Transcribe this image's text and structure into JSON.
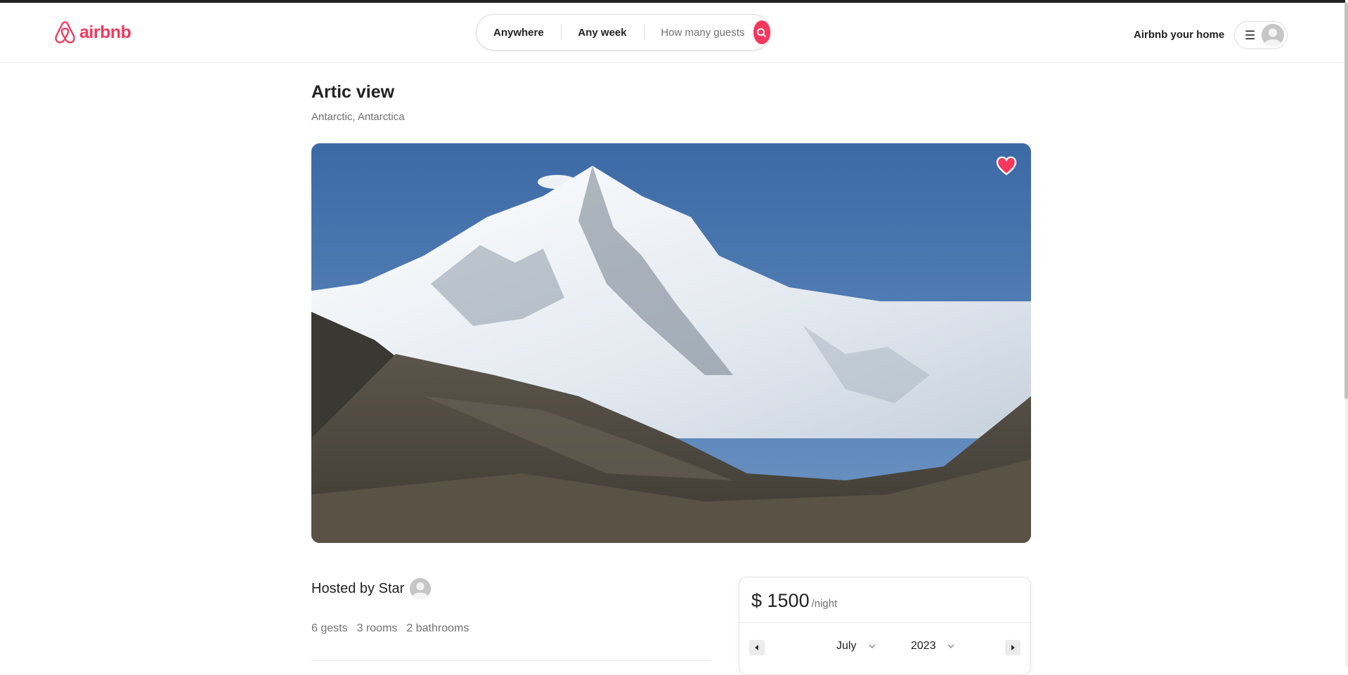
{
  "header": {
    "brand": "airbnb",
    "search": {
      "where": "Anywhere",
      "when": "Any week",
      "guests": "How many guests"
    },
    "host_link": "Airbnb your home",
    "menu_icon": "☰"
  },
  "listing": {
    "title": "Artic view",
    "location": "Antarctic, Antarctica",
    "favorited": true,
    "host_label": "Hosted by Star",
    "stats": [
      "6 gests",
      "3 rooms",
      "2 bathrooms"
    ]
  },
  "booking": {
    "price": "$ 1500",
    "per_night": "/night",
    "calendar": {
      "month": "July",
      "year": "2023"
    }
  },
  "colors": {
    "brand": "#F5385D",
    "text": "#222222",
    "muted": "#717171",
    "border": "#dddddd"
  },
  "icons": {
    "logo": "airbnb-logo-icon",
    "search": "search-icon",
    "menu": "hamburger-menu-icon",
    "avatar": "user-avatar-icon",
    "favorite": "heart-icon",
    "prev": "chevron-left-icon",
    "next": "chevron-right-icon",
    "dropdown": "chevron-down-icon"
  }
}
